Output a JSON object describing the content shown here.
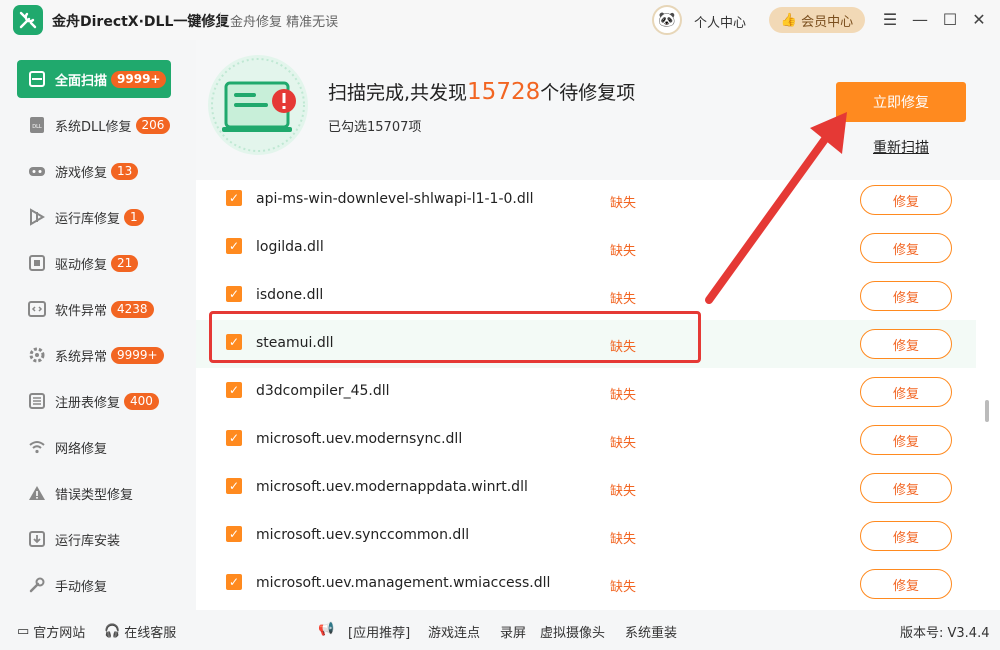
{
  "window": {
    "title": "金舟DirectX·DLL一键修复",
    "slogan": "金舟修复 精准无误",
    "user_center": "个人中心",
    "vip_center": "会员中心"
  },
  "sidebar": {
    "items": [
      {
        "label": "全面扫描",
        "badge": "9999+",
        "icon": "scan-icon",
        "active": true
      },
      {
        "label": "系统DLL修复",
        "badge": "206",
        "icon": "dll-icon"
      },
      {
        "label": "游戏修复",
        "badge": "13",
        "icon": "gamepad-icon"
      },
      {
        "label": "运行库修复",
        "badge": "1",
        "icon": "runtime-icon"
      },
      {
        "label": "驱动修复",
        "badge": "21",
        "icon": "driver-icon"
      },
      {
        "label": "软件异常",
        "badge": "4238",
        "icon": "code-icon"
      },
      {
        "label": "系统异常",
        "badge": "9999+",
        "icon": "gear-icon"
      },
      {
        "label": "注册表修复",
        "badge": "400",
        "icon": "registry-icon"
      },
      {
        "label": "网络修复",
        "badge": "",
        "icon": "wifi-icon"
      },
      {
        "label": "错误类型修复",
        "badge": "",
        "icon": "warning-icon"
      },
      {
        "label": "运行库安装",
        "badge": "",
        "icon": "install-icon"
      },
      {
        "label": "手动修复",
        "badge": "",
        "icon": "wrench-icon"
      }
    ]
  },
  "scan": {
    "title_prefix": "扫描完成,共发现",
    "count": "15728",
    "title_suffix": "个待修复项",
    "selected": "已勾选15707项",
    "fix_now": "立即修复",
    "rescan": "重新扫描"
  },
  "rows": [
    {
      "name": "api-ms-win-downlevel-shlwapi-l1-1-0.dll",
      "status": "缺失",
      "action": "修复"
    },
    {
      "name": "logilda.dll",
      "status": "缺失",
      "action": "修复"
    },
    {
      "name": "isdone.dll",
      "status": "缺失",
      "action": "修复"
    },
    {
      "name": "steamui.dll",
      "status": "缺失",
      "action": "修复"
    },
    {
      "name": "d3dcompiler_45.dll",
      "status": "缺失",
      "action": "修复"
    },
    {
      "name": "microsoft.uev.modernsync.dll",
      "status": "缺失",
      "action": "修复"
    },
    {
      "name": "microsoft.uev.modernappdata.winrt.dll",
      "status": "缺失",
      "action": "修复"
    },
    {
      "name": "microsoft.uev.synccommon.dll",
      "status": "缺失",
      "action": "修复"
    },
    {
      "name": "microsoft.uev.management.wmiaccess.dll",
      "status": "缺失",
      "action": "修复"
    }
  ],
  "footer": {
    "official_site": "官方网站",
    "online_service": "在线客服",
    "recommend": "[应用推荐]",
    "links": [
      "游戏连点",
      "录屏",
      "虚拟摄像头",
      "系统重装"
    ],
    "version": "版本号: V3.4.4"
  },
  "colors": {
    "brand_green": "#20a96d",
    "accent_orange": "#ff8a1f",
    "alert_red": "#e53935"
  }
}
